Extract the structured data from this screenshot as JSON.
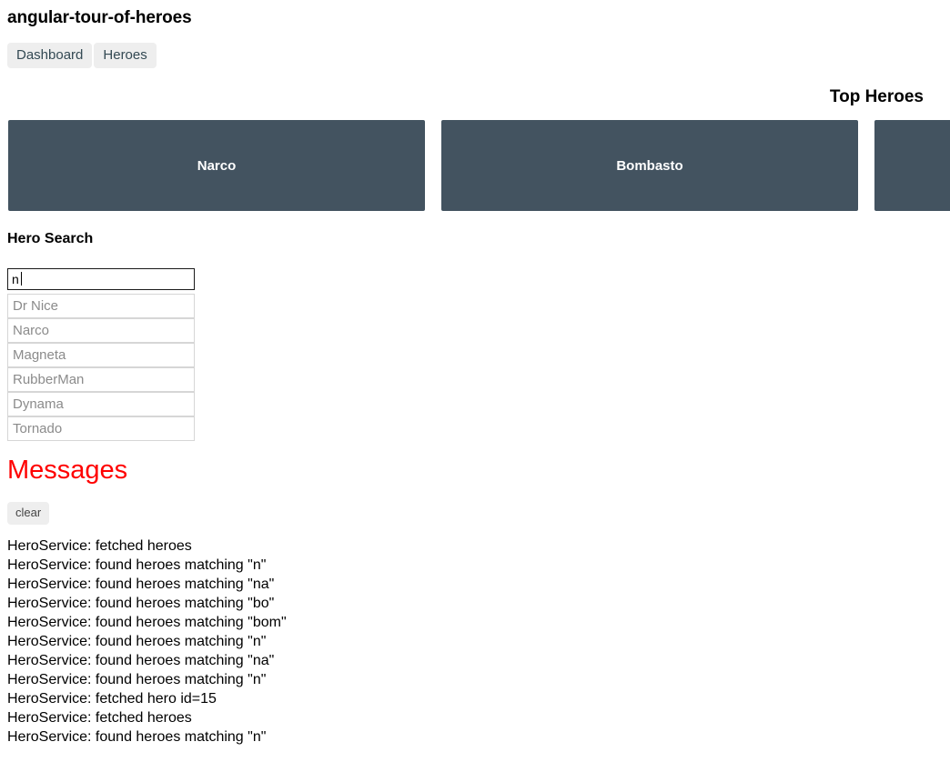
{
  "app": {
    "title": "angular-tour-of-heroes"
  },
  "nav": {
    "items": [
      {
        "label": "Dashboard",
        "name": "nav-link-dashboard"
      },
      {
        "label": "Heroes",
        "name": "nav-link-heroes"
      }
    ]
  },
  "dashboard": {
    "heading": "Top Heroes",
    "heroes": [
      {
        "name": "Narco"
      },
      {
        "name": "Bombasto"
      },
      {
        "name": ""
      }
    ],
    "tile_color": "#435360",
    "tile_text_color": "#ffffff"
  },
  "hero_search": {
    "title": "Hero Search",
    "input_value": "n",
    "input_placeholder": "",
    "results": [
      {
        "name": "Dr Nice"
      },
      {
        "name": "Narco"
      },
      {
        "name": "Magneta"
      },
      {
        "name": "RubberMan"
      },
      {
        "name": "Dynama"
      },
      {
        "name": "Tornado"
      }
    ]
  },
  "messages": {
    "title": "Messages",
    "title_color": "#ff0000",
    "clear_label": "clear",
    "items": [
      "HeroService: fetched heroes",
      "HeroService: found heroes matching \"n\"",
      "HeroService: found heroes matching \"na\"",
      "HeroService: found heroes matching \"bo\"",
      "HeroService: found heroes matching \"bom\"",
      "HeroService: found heroes matching \"n\"",
      "HeroService: found heroes matching \"na\"",
      "HeroService: found heroes matching \"n\"",
      "HeroService: fetched hero id=15",
      "HeroService: fetched heroes",
      "HeroService: found heroes matching \"n\""
    ]
  }
}
